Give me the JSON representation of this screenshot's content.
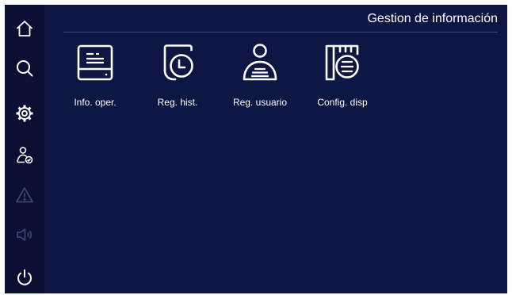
{
  "header": {
    "title": "Gestion de información"
  },
  "sidebar": {
    "items": [
      {
        "name": "home-icon",
        "enabled": true
      },
      {
        "name": "search-icon",
        "enabled": true
      },
      {
        "name": "gear-icon",
        "enabled": true
      },
      {
        "name": "user-check-icon",
        "enabled": true
      },
      {
        "name": "warning-icon",
        "enabled": false
      },
      {
        "name": "speaker-icon",
        "enabled": false
      },
      {
        "name": "power-icon",
        "enabled": true
      }
    ]
  },
  "tiles": [
    {
      "label": "Info. oper.",
      "icon": "document-icon"
    },
    {
      "label": "Reg. hist.",
      "icon": "history-clock-icon"
    },
    {
      "label": "Reg. usuario",
      "icon": "user-record-icon"
    },
    {
      "label": "Config. disp",
      "icon": "device-config-icon"
    }
  ],
  "colors": {
    "background": "#0e1643",
    "sidebar": "#0a1033",
    "icon": "#ffffff",
    "disabled_icon": "#3a4470"
  }
}
